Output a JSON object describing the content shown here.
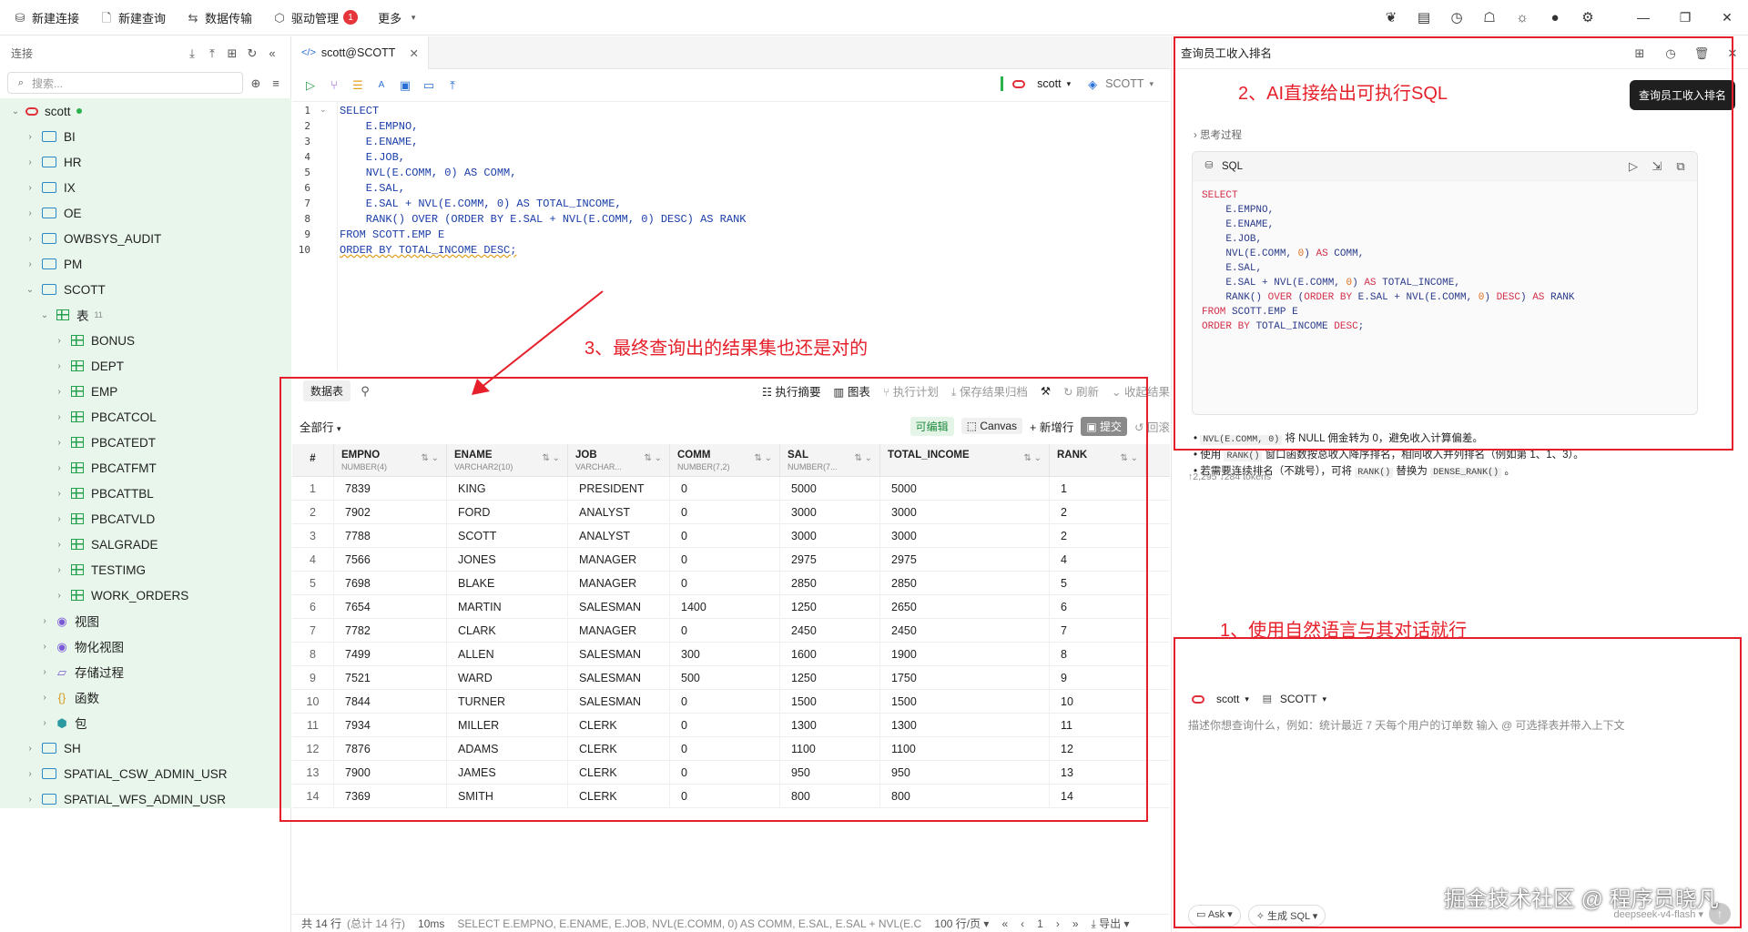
{
  "topbar": {
    "new_connection": "新建连接",
    "new_query": "新建查询",
    "data_transfer": "数据传输",
    "driver_mgmt": "驱动管理",
    "driver_badge": "1",
    "more": "更多"
  },
  "sidebar": {
    "title": "连接",
    "search_placeholder": "搜索...",
    "tree": [
      {
        "label": "scott",
        "level": 0,
        "type": "oracle",
        "expanded": true,
        "online": true
      },
      {
        "label": "BI",
        "level": 1,
        "type": "folder"
      },
      {
        "label": "HR",
        "level": 1,
        "type": "folder"
      },
      {
        "label": "IX",
        "level": 1,
        "type": "folder"
      },
      {
        "label": "OE",
        "level": 1,
        "type": "folder"
      },
      {
        "label": "OWBSYS_AUDIT",
        "level": 1,
        "type": "folder"
      },
      {
        "label": "PM",
        "level": 1,
        "type": "folder"
      },
      {
        "label": "SCOTT",
        "level": 1,
        "type": "folder",
        "expanded": true
      },
      {
        "label": "表",
        "level": 2,
        "type": "table",
        "expanded": true,
        "count": "11"
      },
      {
        "label": "BONUS",
        "level": 3,
        "type": "table"
      },
      {
        "label": "DEPT",
        "level": 3,
        "type": "table"
      },
      {
        "label": "EMP",
        "level": 3,
        "type": "table"
      },
      {
        "label": "PBCATCOL",
        "level": 3,
        "type": "table"
      },
      {
        "label": "PBCATEDT",
        "level": 3,
        "type": "table"
      },
      {
        "label": "PBCATFMT",
        "level": 3,
        "type": "table"
      },
      {
        "label": "PBCATTBL",
        "level": 3,
        "type": "table"
      },
      {
        "label": "PBCATVLD",
        "level": 3,
        "type": "table"
      },
      {
        "label": "SALGRADE",
        "level": 3,
        "type": "table"
      },
      {
        "label": "TESTIMG",
        "level": 3,
        "type": "table"
      },
      {
        "label": "WORK_ORDERS",
        "level": 3,
        "type": "table"
      },
      {
        "label": "视图",
        "level": 2,
        "type": "view"
      },
      {
        "label": "物化视图",
        "level": 2,
        "type": "view"
      },
      {
        "label": "存储过程",
        "level": 2,
        "type": "proc"
      },
      {
        "label": "函数",
        "level": 2,
        "type": "func"
      },
      {
        "label": "包",
        "level": 2,
        "type": "pkg"
      },
      {
        "label": "SH",
        "level": 1,
        "type": "folder"
      },
      {
        "label": "SPATIAL_CSW_ADMIN_USR",
        "level": 1,
        "type": "folder"
      },
      {
        "label": "SPATIAL_WFS_ADMIN_USR",
        "level": 1,
        "type": "folder"
      }
    ]
  },
  "editor": {
    "tab": "scott@SCOTT",
    "conn": "scott",
    "schema": "SCOTT",
    "lines": [
      "SELECT",
      "    E.EMPNO,",
      "    E.ENAME,",
      "    E.JOB,",
      "    NVL(E.COMM, 0) AS COMM,",
      "    E.SAL,",
      "    E.SAL + NVL(E.COMM, 0) AS TOTAL_INCOME,",
      "    RANK() OVER (ORDER BY E.SAL + NVL(E.COMM, 0) DESC) AS RANK",
      "FROM SCOTT.EMP E",
      "ORDER BY TOTAL_INCOME DESC;"
    ]
  },
  "result": {
    "tab": "数据表",
    "summary": "执行摘要",
    "chart": "图表",
    "plan": "执行计划",
    "save": "保存结果归档",
    "refresh": "刷新",
    "collapse": "收起结果",
    "all_rows": "全部行",
    "editable": "可编辑",
    "canvas": "Canvas",
    "add_row": "新增行",
    "submit": "提交",
    "rollback": "回滚",
    "columns": [
      {
        "name": "#",
        "type": ""
      },
      {
        "name": "EMPNO",
        "type": "NUMBER(4)"
      },
      {
        "name": "ENAME",
        "type": "VARCHAR2(10)"
      },
      {
        "name": "JOB",
        "type": "VARCHAR..."
      },
      {
        "name": "COMM",
        "type": "NUMBER(7,2)"
      },
      {
        "name": "SAL",
        "type": "NUMBER(7..."
      },
      {
        "name": "TOTAL_INCOME",
        "type": ""
      },
      {
        "name": "RANK",
        "type": ""
      }
    ],
    "rows": [
      [
        "1",
        "7839",
        "KING",
        "PRESIDENT",
        "0",
        "5000",
        "5000",
        "1"
      ],
      [
        "2",
        "7902",
        "FORD",
        "ANALYST",
        "0",
        "3000",
        "3000",
        "2"
      ],
      [
        "3",
        "7788",
        "SCOTT",
        "ANALYST",
        "0",
        "3000",
        "3000",
        "2"
      ],
      [
        "4",
        "7566",
        "JONES",
        "MANAGER",
        "0",
        "2975",
        "2975",
        "4"
      ],
      [
        "5",
        "7698",
        "BLAKE",
        "MANAGER",
        "0",
        "2850",
        "2850",
        "5"
      ],
      [
        "6",
        "7654",
        "MARTIN",
        "SALESMAN",
        "1400",
        "1250",
        "2650",
        "6"
      ],
      [
        "7",
        "7782",
        "CLARK",
        "MANAGER",
        "0",
        "2450",
        "2450",
        "7"
      ],
      [
        "8",
        "7499",
        "ALLEN",
        "SALESMAN",
        "300",
        "1600",
        "1900",
        "8"
      ],
      [
        "9",
        "7521",
        "WARD",
        "SALESMAN",
        "500",
        "1250",
        "1750",
        "9"
      ],
      [
        "10",
        "7844",
        "TURNER",
        "SALESMAN",
        "0",
        "1500",
        "1500",
        "10"
      ],
      [
        "11",
        "7934",
        "MILLER",
        "CLERK",
        "0",
        "1300",
        "1300",
        "11"
      ],
      [
        "12",
        "7876",
        "ADAMS",
        "CLERK",
        "0",
        "1100",
        "1100",
        "12"
      ],
      [
        "13",
        "7900",
        "JAMES",
        "CLERK",
        "0",
        "950",
        "950",
        "13"
      ],
      [
        "14",
        "7369",
        "SMITH",
        "CLERK",
        "0",
        "800",
        "800",
        "14"
      ]
    ]
  },
  "status": {
    "rows": "共 14 行",
    "total": "(总计 14 行)",
    "time": "10ms",
    "sql": "SELECT E.EMPNO, E.ENAME, E.JOB, NVL(E.COMM, 0) AS COMM, E.SAL, E.SAL + NVL(E.CO...",
    "page_size": "100 行/页",
    "page": "1",
    "export": "导出"
  },
  "ai": {
    "title": "查询员工收入排名",
    "tooltip": "查询员工收入排名",
    "think": "思考过程",
    "sql_label": "SQL",
    "bullets": [
      {
        "code": "NVL(E.COMM, 0)",
        "text": "将 NULL 佣金转为 0，避免收入计算偏差。"
      },
      {
        "pre": "使用",
        "code": "RANK()",
        "text": "窗口函数按总收入降序排名，相同收入并列排名（例如第 1、1、3）。"
      },
      {
        "pre": "若需要连续排名（不跳号），可将",
        "code": "RANK()",
        "mid": "替换为",
        "code2": "DENSE_RANK()",
        "text": "。"
      }
    ],
    "tokens": "↑2,295 ↓284 tokens",
    "compose_conn": "scott",
    "compose_schema": "SCOTT",
    "placeholder": "描述你想查询什么，例如：统计最近 7 天每个用户的订单数 输入 @ 可选择表并带入上下文",
    "ask": "Ask",
    "gen_sql": "生成 SQL",
    "model": "deepseek-v4-flash"
  },
  "annotations": {
    "a1": "1、使用自然语言与其对话就行",
    "a2": "2、AI直接给出可执行SQL",
    "a3": "3、最终查询出的结果集也还是对的"
  },
  "watermark": "掘金技术社区 @ 程序员晓凡",
  "colors": {
    "accent": "#2a6fd6",
    "annotation": "#e5202a",
    "tree_bg": "#e8f6ec"
  }
}
